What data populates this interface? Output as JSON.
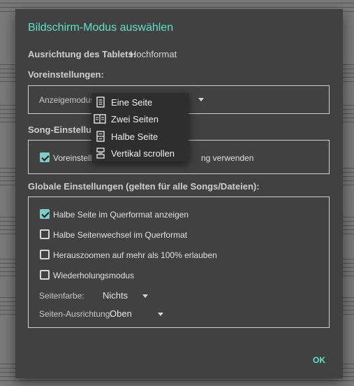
{
  "dialog": {
    "title": "Bildschirm-Modus auswählen",
    "orientation_label": "Ausrichtung des Tablets:",
    "orientation_value": "Hochformat",
    "presets_heading": "Voreinstellungen:",
    "display_mode_label": "Anzeigemodus:",
    "song_settings_heading": "Song-Einstellung",
    "song_settings_checkbox_left": "Voreinstell",
    "song_settings_checkbox_right": "ng verwenden",
    "song_settings_checked": true,
    "global_heading": "Globale Einstellungen (gelten für alle Songs/Dateien):",
    "global_options": [
      {
        "label": "Halbe Seite im Querformat anzeigen",
        "checked": true
      },
      {
        "label": "Halbe Seitenwechsel im Querformat",
        "checked": false
      },
      {
        "label": "Herauszoomen auf mehr als 100% erlauben",
        "checked": false
      },
      {
        "label": "Wiederholungsmodus",
        "checked": false
      }
    ],
    "page_color_label": "Seitenfarbe:",
    "page_color_value": "Nichts",
    "page_align_label": "Seiten-Ausrichtung:",
    "page_align_value": "Oben",
    "ok_label": "OK"
  },
  "menu": {
    "items": [
      {
        "label": "Eine Seite",
        "icon": "single-page-icon"
      },
      {
        "label": "Zwei Seiten",
        "icon": "two-pages-icon"
      },
      {
        "label": "Halbe Seite",
        "icon": "half-page-icon"
      },
      {
        "label": "Vertikal scrollen",
        "icon": "vertical-scroll-icon"
      }
    ]
  },
  "colors": {
    "accent": "#5ee3c7",
    "checkbox": "#80cbc4",
    "dialog_bg": "#414141",
    "menu_bg": "#2e2e2e"
  }
}
